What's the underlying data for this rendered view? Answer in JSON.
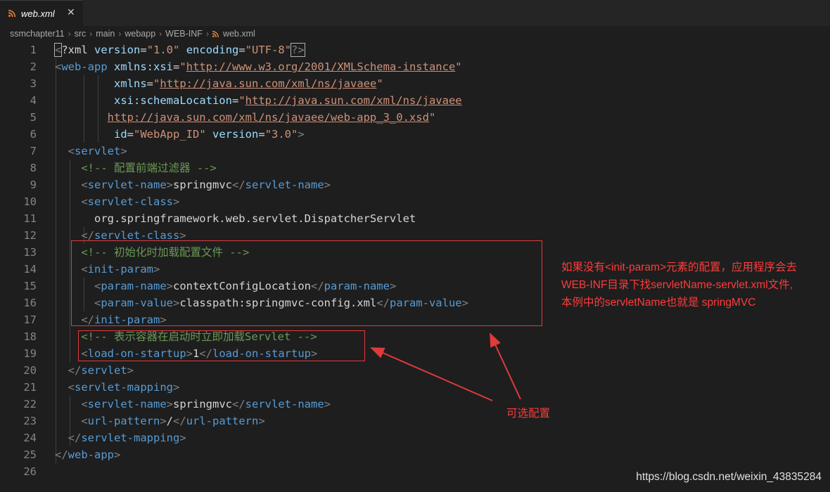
{
  "tab": {
    "title": "web.xml",
    "close": "✕",
    "icon": "rss-icon"
  },
  "breadcrumb": [
    "ssmchapter11",
    "src",
    "main",
    "webapp",
    "WEB-INF",
    "web.xml"
  ],
  "lines": [
    [
      [
        "p",
        "<"
      ],
      [
        "x",
        "?xml "
      ],
      [
        "a",
        "version"
      ],
      [
        "x",
        "="
      ],
      [
        "s",
        "\"1.0\""
      ],
      [
        "x",
        " "
      ],
      [
        "a",
        "encoding"
      ],
      [
        "x",
        "="
      ],
      [
        "s",
        "\"UTF-8\""
      ],
      [
        "p",
        "?>"
      ]
    ],
    [
      [
        "p",
        "<"
      ],
      [
        "t",
        "web-app "
      ],
      [
        "a",
        "xmlns:xsi"
      ],
      [
        "x",
        "="
      ],
      [
        "s",
        "\""
      ],
      [
        "u",
        "http://www.w3.org/2001/XMLSchema-instance"
      ],
      [
        "s",
        "\""
      ]
    ],
    [
      [
        "x",
        "         "
      ],
      [
        "a",
        "xmlns"
      ],
      [
        "x",
        "="
      ],
      [
        "s",
        "\""
      ],
      [
        "u",
        "http://java.sun.com/xml/ns/javaee"
      ],
      [
        "s",
        "\""
      ]
    ],
    [
      [
        "x",
        "         "
      ],
      [
        "a",
        "xsi:schemaLocation"
      ],
      [
        "x",
        "="
      ],
      [
        "s",
        "\""
      ],
      [
        "u",
        "http://java.sun.com/xml/ns/javaee"
      ]
    ],
    [
      [
        "x",
        "        "
      ],
      [
        "u",
        "http://java.sun.com/xml/ns/javaee/web-app_3_0.xsd"
      ],
      [
        "s",
        "\""
      ]
    ],
    [
      [
        "x",
        "         "
      ],
      [
        "a",
        "id"
      ],
      [
        "x",
        "="
      ],
      [
        "s",
        "\"WebApp_ID\""
      ],
      [
        "x",
        " "
      ],
      [
        "a",
        "version"
      ],
      [
        "x",
        "="
      ],
      [
        "s",
        "\"3.0\""
      ],
      [
        "p",
        ">"
      ]
    ],
    [
      [
        "x",
        "  "
      ],
      [
        "p",
        "<"
      ],
      [
        "t",
        "servlet"
      ],
      [
        "p",
        ">"
      ]
    ],
    [
      [
        "x",
        "    "
      ],
      [
        "c",
        "<!-- 配置前端过滤器 -->"
      ]
    ],
    [
      [
        "x",
        "    "
      ],
      [
        "p",
        "<"
      ],
      [
        "t",
        "servlet-name"
      ],
      [
        "p",
        ">"
      ],
      [
        "x",
        "springmvc"
      ],
      [
        "p",
        "</"
      ],
      [
        "t",
        "servlet-name"
      ],
      [
        "p",
        ">"
      ]
    ],
    [
      [
        "x",
        "    "
      ],
      [
        "p",
        "<"
      ],
      [
        "t",
        "servlet-class"
      ],
      [
        "p",
        ">"
      ]
    ],
    [
      [
        "x",
        "      org.springframework.web.servlet.DispatcherServlet"
      ]
    ],
    [
      [
        "x",
        "    "
      ],
      [
        "p",
        "</"
      ],
      [
        "t",
        "servlet-class"
      ],
      [
        "p",
        ">"
      ]
    ],
    [
      [
        "x",
        "    "
      ],
      [
        "c",
        "<!-- 初始化时加载配置文件 -->"
      ]
    ],
    [
      [
        "x",
        "    "
      ],
      [
        "p",
        "<"
      ],
      [
        "t",
        "init-param"
      ],
      [
        "p",
        ">"
      ]
    ],
    [
      [
        "x",
        "      "
      ],
      [
        "p",
        "<"
      ],
      [
        "t",
        "param-name"
      ],
      [
        "p",
        ">"
      ],
      [
        "x",
        "contextConfigLocation"
      ],
      [
        "p",
        "</"
      ],
      [
        "t",
        "param-name"
      ],
      [
        "p",
        ">"
      ]
    ],
    [
      [
        "x",
        "      "
      ],
      [
        "p",
        "<"
      ],
      [
        "t",
        "param-value"
      ],
      [
        "p",
        ">"
      ],
      [
        "x",
        "classpath:springmvc-config.xml"
      ],
      [
        "p",
        "</"
      ],
      [
        "t",
        "param-value"
      ],
      [
        "p",
        ">"
      ]
    ],
    [
      [
        "x",
        "    "
      ],
      [
        "p",
        "</"
      ],
      [
        "t",
        "init-param"
      ],
      [
        "p",
        ">"
      ]
    ],
    [
      [
        "x",
        "    "
      ],
      [
        "c",
        "<!-- 表示容器在启动时立即加载Servlet -->"
      ]
    ],
    [
      [
        "x",
        "    "
      ],
      [
        "p",
        "<"
      ],
      [
        "t",
        "load-on-startup"
      ],
      [
        "p",
        ">"
      ],
      [
        "x",
        "1"
      ],
      [
        "p",
        "</"
      ],
      [
        "t",
        "load-on-startup"
      ],
      [
        "p",
        ">"
      ]
    ],
    [
      [
        "x",
        "  "
      ],
      [
        "p",
        "</"
      ],
      [
        "t",
        "servlet"
      ],
      [
        "p",
        ">"
      ]
    ],
    [
      [
        "x",
        "  "
      ],
      [
        "p",
        "<"
      ],
      [
        "t",
        "servlet-mapping"
      ],
      [
        "p",
        ">"
      ]
    ],
    [
      [
        "x",
        "    "
      ],
      [
        "p",
        "<"
      ],
      [
        "t",
        "servlet-name"
      ],
      [
        "p",
        ">"
      ],
      [
        "x",
        "springmvc"
      ],
      [
        "p",
        "</"
      ],
      [
        "t",
        "servlet-name"
      ],
      [
        "p",
        ">"
      ]
    ],
    [
      [
        "x",
        "    "
      ],
      [
        "p",
        "<"
      ],
      [
        "t",
        "url-pattern"
      ],
      [
        "p",
        ">"
      ],
      [
        "x",
        "/"
      ],
      [
        "p",
        "</"
      ],
      [
        "t",
        "url-pattern"
      ],
      [
        "p",
        ">"
      ]
    ],
    [
      [
        "x",
        "  "
      ],
      [
        "p",
        "</"
      ],
      [
        "t",
        "servlet-mapping"
      ],
      [
        "p",
        ">"
      ]
    ],
    [
      [
        "p",
        "</"
      ],
      [
        "t",
        "web-app"
      ],
      [
        "p",
        ">"
      ]
    ],
    []
  ],
  "annotation": {
    "note_lines": [
      "如果没有<init-param>元素的配置，应用程序会去",
      "WEB-INF目录下找servletName-servlet.xml文件,",
      "本例中的servletName也就是 springMVC"
    ],
    "optional_label": "可选配置",
    "color": "#ff3b3b"
  },
  "watermark": "https://blog.csdn.net/weixin_43835284"
}
